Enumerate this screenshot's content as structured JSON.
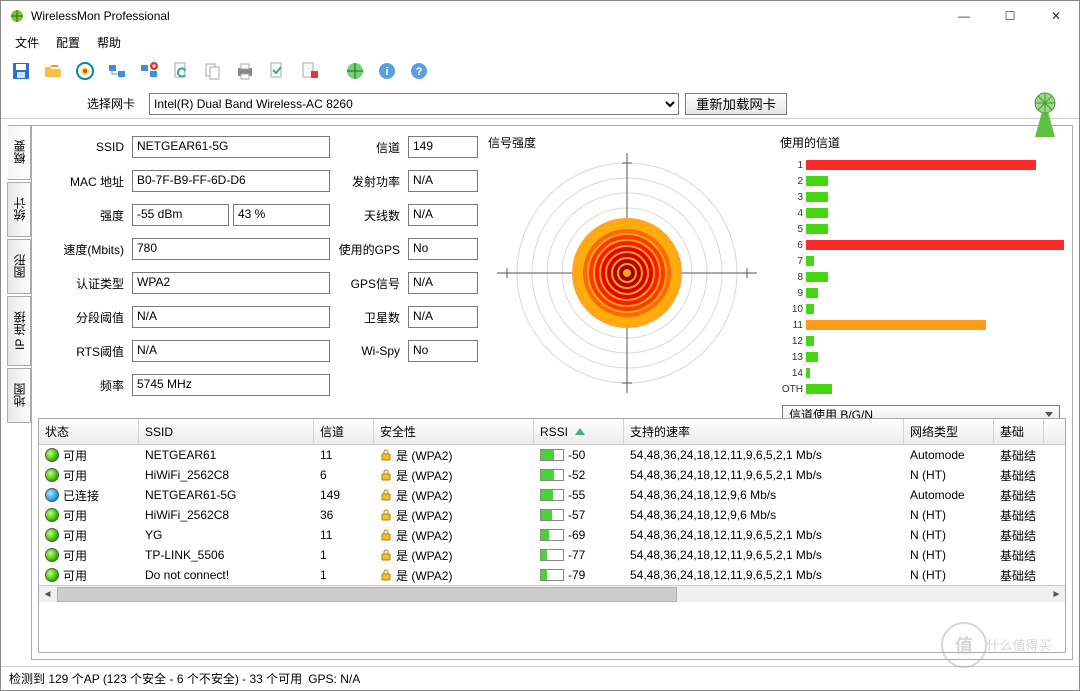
{
  "window_title": "WirelessMon Professional",
  "menu": {
    "file": "文件",
    "config": "配置",
    "help": "帮助"
  },
  "adapter_row": {
    "label": "选择网卡",
    "value": "Intel(R) Dual Band Wireless-AC 8260",
    "reload": "重新加载网卡"
  },
  "vtabs": [
    "概要",
    "统计",
    "图形",
    "IP 连接",
    "地图"
  ],
  "fields": {
    "ssid_label": "SSID",
    "ssid": "NETGEAR61-5G",
    "channel_label": "信道",
    "channel": "149",
    "mac_label": "MAC 地址",
    "mac": "B0-7F-B9-FF-6D-D6",
    "txpower_label": "发射功率",
    "txpower": "N/A",
    "strength_label": "强度",
    "strength_dbm": "-55 dBm",
    "strength_pct": "43 %",
    "antenna_label": "天线数",
    "antenna": "N/A",
    "speed_label": "速度(Mbits)",
    "speed": "780",
    "gpsused_label": "使用的GPS",
    "gpsused": "No",
    "auth_label": "认证类型",
    "auth": "WPA2",
    "gpssig_label": "GPS信号",
    "gpssig": "N/A",
    "frag_label": "分段阈值",
    "frag": "N/A",
    "sat_label": "卫星数",
    "sat": "N/A",
    "rts_label": "RTS阈值",
    "rts": "N/A",
    "wispy_label": "Wi-Spy",
    "wispy": "No",
    "freq_label": "频率",
    "freq": "5745 MHz"
  },
  "signal_header": "信号强度",
  "channel_header": "使用的信道",
  "chart_data": {
    "type": "bar",
    "title": "使用的信道",
    "xlabel": "",
    "ylabel": "",
    "categories": [
      "1",
      "2",
      "3",
      "4",
      "5",
      "6",
      "7",
      "8",
      "9",
      "10",
      "11",
      "12",
      "13",
      "14",
      "OTH"
    ],
    "values": [
      230,
      22,
      22,
      22,
      22,
      260,
      8,
      22,
      12,
      8,
      180,
      8,
      12,
      4,
      26
    ],
    "colors": [
      "#ff2a2a",
      "#44d613",
      "#44d613",
      "#44d613",
      "#44d613",
      "#ff2a2a",
      "#44d613",
      "#44d613",
      "#44d613",
      "#44d613",
      "#ff9a1a",
      "#44d613",
      "#44d613",
      "#44d613",
      "#44d613"
    ]
  },
  "channel_mode_select": "信道使用 B/G/N",
  "columns": {
    "status": "状态",
    "ssid": "SSID",
    "chan": "信道",
    "sec": "安全性",
    "rssi": "RSSI",
    "rates": "支持的速率",
    "net": "网络类型",
    "inf": "基础"
  },
  "sec_yes_wpa2": "是 (WPA2)",
  "ap": [
    {
      "status": "可用",
      "dot": "green",
      "ssid": "NETGEAR61",
      "chan": "11",
      "rssi": -50,
      "sig": 60,
      "rates": "54,48,36,24,18,12,11,9,6,5,2,1 Mb/s",
      "net": "Automode",
      "inf": "基础结"
    },
    {
      "status": "可用",
      "dot": "green",
      "ssid": "HiWiFi_2562C8",
      "chan": "6",
      "rssi": -52,
      "sig": 58,
      "rates": "54,48,36,24,18,12,11,9,6,5,2,1 Mb/s",
      "net": "N (HT)",
      "inf": "基础结"
    },
    {
      "status": "已连接",
      "dot": "blue",
      "ssid": "NETGEAR61-5G",
      "chan": "149",
      "rssi": -55,
      "sig": 55,
      "rates": "54,48,36,24,18,12,9,6 Mb/s",
      "net": "Automode",
      "inf": "基础结"
    },
    {
      "status": "可用",
      "dot": "green",
      "ssid": "HiWiFi_2562C8",
      "chan": "36",
      "rssi": -57,
      "sig": 52,
      "rates": "54,48,36,24,18,12,9,6 Mb/s",
      "net": "N (HT)",
      "inf": "基础结"
    },
    {
      "status": "可用",
      "dot": "green",
      "ssid": "YG",
      "chan": "11",
      "rssi": -69,
      "sig": 38,
      "rates": "54,48,36,24,18,12,11,9,6,5,2,1 Mb/s",
      "net": "N (HT)",
      "inf": "基础结"
    },
    {
      "status": "可用",
      "dot": "green",
      "ssid": "TP-LINK_5506",
      "chan": "1",
      "rssi": -77,
      "sig": 28,
      "rates": "54,48,36,24,18,12,11,9,6,5,2,1 Mb/s",
      "net": "N (HT)",
      "inf": "基础结"
    },
    {
      "status": "可用",
      "dot": "green",
      "ssid": "Do not connect!",
      "chan": "1",
      "rssi": -79,
      "sig": 25,
      "rates": "54,48,36,24,18,12,11,9,6,5,2,1 Mb/s",
      "net": "N (HT)",
      "inf": "基础结"
    }
  ],
  "statusbar": {
    "text": "检测到 129 个AP (123 个安全 - 6 个不安全) - 33 个可用",
    "gps": "GPS: N/A"
  },
  "watermark": "什么值得买"
}
